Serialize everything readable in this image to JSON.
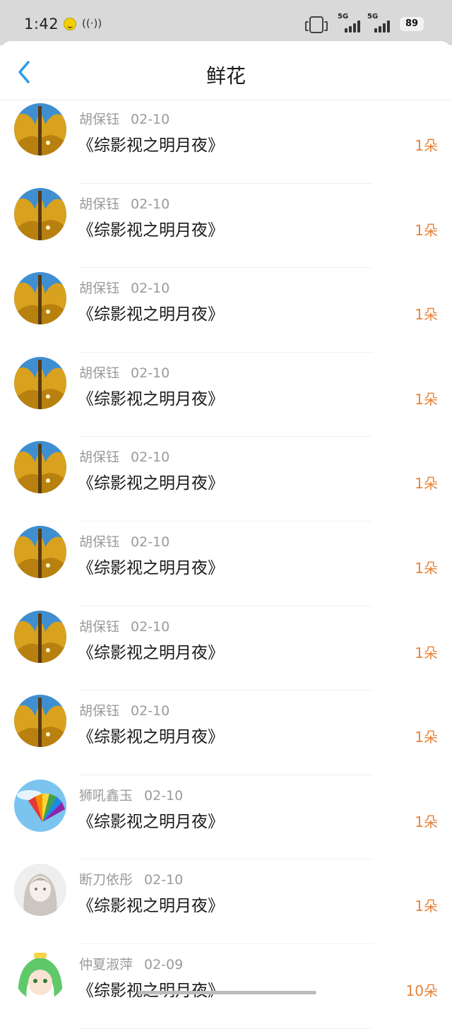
{
  "status_bar": {
    "time": "1:42",
    "hotspot_glyph": "((·))",
    "signal1_label": "5G",
    "signal2_label": "5G",
    "battery": "89"
  },
  "nav": {
    "title": "鲜花",
    "back_icon": "chevron-left-icon"
  },
  "items": [
    {
      "name": "胡保钰",
      "date": "02-10",
      "title": "《综影视之明月夜》",
      "count": "1朵",
      "avatar": "forest"
    },
    {
      "name": "胡保钰",
      "date": "02-10",
      "title": "《综影视之明月夜》",
      "count": "1朵",
      "avatar": "forest"
    },
    {
      "name": "胡保钰",
      "date": "02-10",
      "title": "《综影视之明月夜》",
      "count": "1朵",
      "avatar": "forest"
    },
    {
      "name": "胡保钰",
      "date": "02-10",
      "title": "《综影视之明月夜》",
      "count": "1朵",
      "avatar": "forest"
    },
    {
      "name": "胡保钰",
      "date": "02-10",
      "title": "《综影视之明月夜》",
      "count": "1朵",
      "avatar": "forest"
    },
    {
      "name": "胡保钰",
      "date": "02-10",
      "title": "《综影视之明月夜》",
      "count": "1朵",
      "avatar": "forest"
    },
    {
      "name": "胡保钰",
      "date": "02-10",
      "title": "《综影视之明月夜》",
      "count": "1朵",
      "avatar": "forest"
    },
    {
      "name": "胡保钰",
      "date": "02-10",
      "title": "《综影视之明月夜》",
      "count": "1朵",
      "avatar": "forest"
    },
    {
      "name": "狮吼鑫玉",
      "date": "02-10",
      "title": "《综影视之明月夜》",
      "count": "1朵",
      "avatar": "rainbow-fan"
    },
    {
      "name": "断刀依彤",
      "date": "02-10",
      "title": "《综影视之明月夜》",
      "count": "1朵",
      "avatar": "anime-girl"
    },
    {
      "name": "仲夏淑萍",
      "date": "02-09",
      "title": "《综影视之明月夜》",
      "count": "10朵",
      "avatar": "green-hair"
    }
  ],
  "colors": {
    "accent": "#2f9bea",
    "count": "#e8833a",
    "meta": "#9a9a9a",
    "status_bg": "#d9d9d9"
  }
}
